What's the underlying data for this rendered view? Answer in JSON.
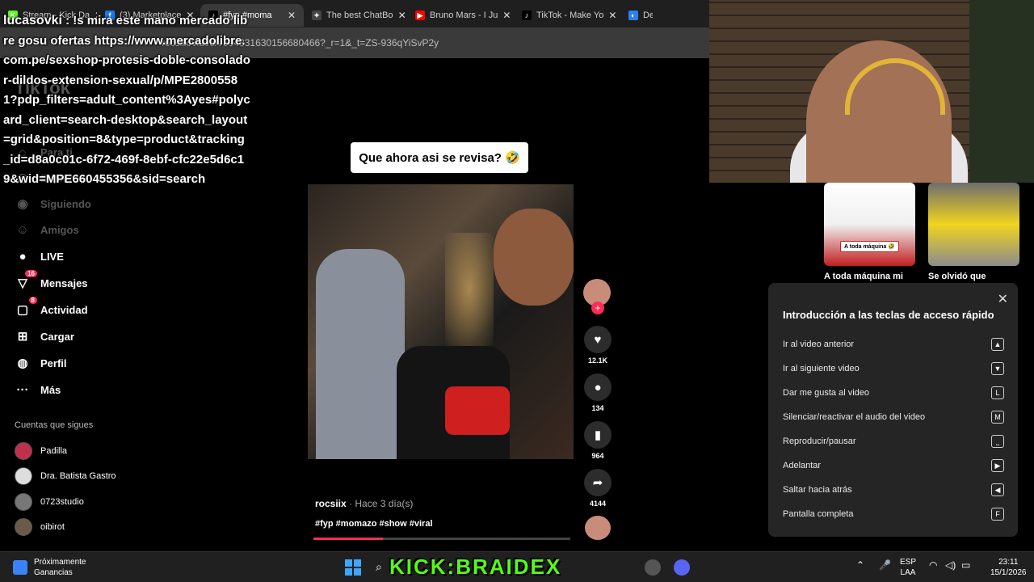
{
  "browser": {
    "tabs": [
      {
        "label": "Stream - Kick Da",
        "color": "#53fc18",
        "glyph": "K",
        "active": false
      },
      {
        "label": "(3) Marketplace",
        "color": "#1877f2",
        "glyph": "f",
        "active": false
      },
      {
        "label": "#fyp #moma",
        "color": "#000000",
        "glyph": "♪",
        "active": true
      },
      {
        "label": "The best ChatBo",
        "color": "#444444",
        "glyph": "✦",
        "active": false
      },
      {
        "label": "Bruno Mars - I Ju",
        "color": "#ff0000",
        "glyph": "▶",
        "active": false
      },
      {
        "label": "TikTok - Make Yo",
        "color": "#000000",
        "glyph": "♪",
        "active": false
      },
      {
        "label": "Desc",
        "color": "#2f80ed",
        "glyph": "◐",
        "active": false
      }
    ],
    "url": "rocsiix/video/7594331630156680466?_r=1&_t=ZS-936qYiSvP2y"
  },
  "chat": {
    "username": "lucasovki",
    "message": "!s mira este mano mercado libre gosu ofertas https://www.mercadolibre.com.pe/sexshop-protesis-doble-consolador-dildos-extension-sexual/p/MPE28005581?pdp_filters=adult_content%3Ayes#polycard_client=search-desktop&search_layout=grid&position=8&type=product&tracking_id=d8a0c01c-6f72-469f-8ebf-cfc22e5d6c19&wid=MPE660455356&sid=search"
  },
  "sidebar": {
    "logo": "TikTok",
    "items": [
      {
        "label": "Para ti",
        "icon": "home-icon",
        "glyph": "⌂",
        "dim": true,
        "badge": ""
      },
      {
        "label": "Explorar",
        "icon": "compass-icon",
        "glyph": "◎",
        "dim": true,
        "badge": ""
      },
      {
        "label": "Siguiendo",
        "icon": "following-icon",
        "glyph": "◉",
        "dim": true,
        "badge": ""
      },
      {
        "label": "Amigos",
        "icon": "friends-icon",
        "glyph": "☺",
        "dim": true,
        "badge": ""
      },
      {
        "label": "LIVE",
        "icon": "live-icon",
        "glyph": "●",
        "dim": false,
        "badge": ""
      },
      {
        "label": "Mensajes",
        "icon": "messages-icon",
        "glyph": "▽",
        "dim": false,
        "badge": "16"
      },
      {
        "label": "Actividad",
        "icon": "activity-icon",
        "glyph": "▢",
        "dim": false,
        "badge": "8"
      },
      {
        "label": "Cargar",
        "icon": "upload-icon",
        "glyph": "⊞",
        "dim": false,
        "badge": ""
      },
      {
        "label": "Perfil",
        "icon": "profile-icon",
        "glyph": "◍",
        "dim": false,
        "badge": ""
      },
      {
        "label": "Más",
        "icon": "more-icon",
        "glyph": "···",
        "dim": false,
        "badge": ""
      }
    ],
    "following_title": "Cuentas que sigues",
    "following": [
      {
        "name": "Padilla",
        "color": "#c0304a"
      },
      {
        "name": "Dra. Batista Gastro",
        "color": "#dddddd"
      },
      {
        "name": "0723studio",
        "color": "#777777"
      },
      {
        "name": "oibirot",
        "color": "#6b5a4a"
      }
    ]
  },
  "video": {
    "sticker": "Que ahora asi se revisa? 🤣",
    "author": "rocsiix",
    "when": " · Hace 3 día(s)",
    "tags": "#fyp #momazo #show #viral",
    "progress": 0.27
  },
  "actions": {
    "likes": "12.1K",
    "comments": "134",
    "saves": "964",
    "shares": "4144"
  },
  "recommendations": [
    {
      "title": "A toda máquina mi",
      "tag": "A toda máquina 🤣"
    },
    {
      "title": "Se olvidó que",
      "tag": ""
    }
  ],
  "shortcuts": {
    "title": "Introducción a las teclas de acceso rápido",
    "items": [
      {
        "label": "Ir al video anterior",
        "key": "▲"
      },
      {
        "label": "Ir al siguiente video",
        "key": "▼"
      },
      {
        "label": "Dar me gusta al video",
        "key": "L"
      },
      {
        "label": "Silenciar/reactivar el audio del video",
        "key": "M"
      },
      {
        "label": "Reproducir/pausar",
        "key": "⎵"
      },
      {
        "label": "Adelantar",
        "key": "▶"
      },
      {
        "label": "Saltar hacia atrás",
        "key": "◀"
      },
      {
        "label": "Pantalla completa",
        "key": "F"
      }
    ]
  },
  "taskbar": {
    "weather_line1": "Próximamente",
    "weather_line2": "Ganancias",
    "overlay": "KICK:BRAIDEX",
    "lang1": "ESP",
    "lang2": "LAA",
    "time": "23:11",
    "date": "15/1/2026"
  }
}
